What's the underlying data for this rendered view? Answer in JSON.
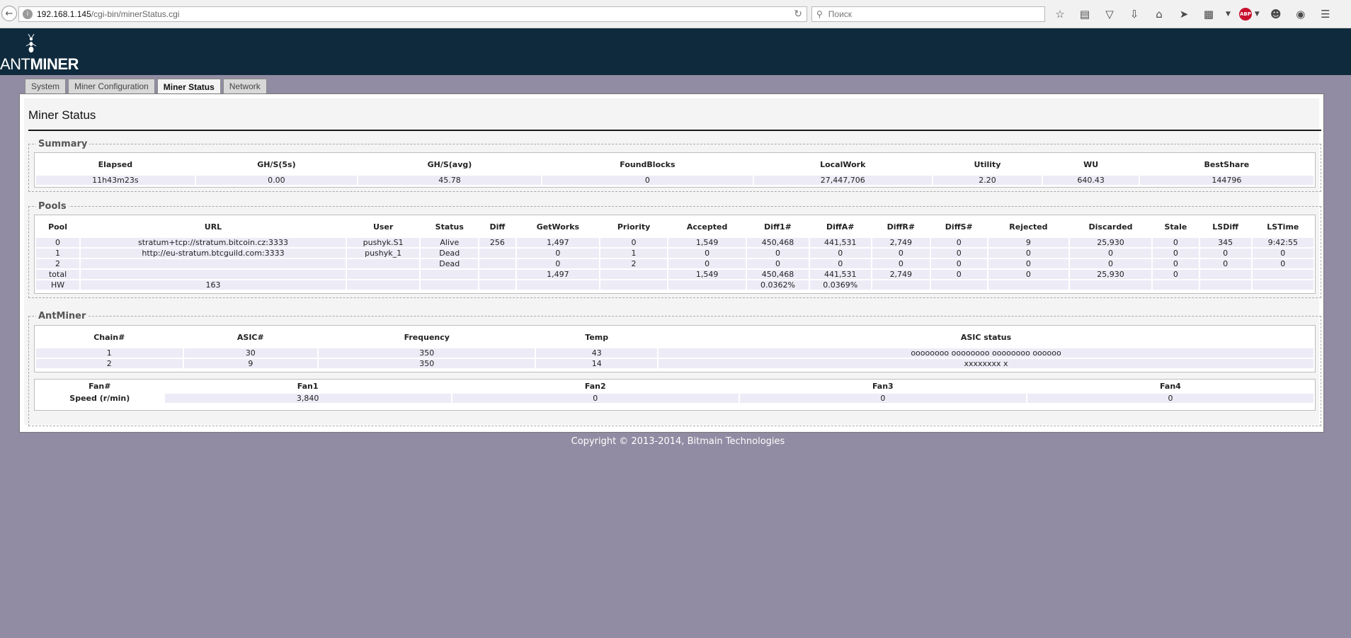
{
  "browser": {
    "url_host": "192.168.1.145",
    "url_path": "/cgi-bin/minerStatus.cgi",
    "search_placeholder": "Поиск",
    "abp_label": "ABP"
  },
  "brand": {
    "logo_ant": "ANT",
    "logo_miner": "MINER"
  },
  "tabs": [
    {
      "label": "System",
      "active": false
    },
    {
      "label": "Miner Configuration",
      "active": false
    },
    {
      "label": "Miner Status",
      "active": true
    },
    {
      "label": "Network",
      "active": false
    }
  ],
  "page_title": "Miner Status",
  "summary": {
    "legend": "Summary",
    "headers": [
      "Elapsed",
      "GH/S(5s)",
      "GH/S(avg)",
      "FoundBlocks",
      "LocalWork",
      "Utility",
      "WU",
      "BestShare"
    ],
    "row": [
      "11h43m23s",
      "0.00",
      "45.78",
      "0",
      "27,447,706",
      "2.20",
      "640.43",
      "144796"
    ]
  },
  "pools": {
    "legend": "Pools",
    "headers": [
      "Pool",
      "URL",
      "User",
      "Status",
      "Diff",
      "GetWorks",
      "Priority",
      "Accepted",
      "Diff1#",
      "DiffA#",
      "DiffR#",
      "DiffS#",
      "Rejected",
      "Discarded",
      "Stale",
      "LSDiff",
      "LSTime"
    ],
    "rows": [
      [
        "0",
        "stratum+tcp://stratum.bitcoin.cz:3333",
        "pushyk.S1",
        "Alive",
        "256",
        "1,497",
        "0",
        "1,549",
        "450,468",
        "441,531",
        "2,749",
        "0",
        "9",
        "25,930",
        "0",
        "345",
        "9:42:55"
      ],
      [
        "1",
        "http://eu-stratum.btcguild.com:3333",
        "pushyk_1",
        "Dead",
        "",
        "0",
        "1",
        "0",
        "0",
        "0",
        "0",
        "0",
        "0",
        "0",
        "0",
        "0",
        "0"
      ],
      [
        "2",
        "",
        "",
        "Dead",
        "",
        "0",
        "2",
        "0",
        "0",
        "0",
        "0",
        "0",
        "0",
        "0",
        "0",
        "0",
        "0"
      ],
      [
        "total",
        "",
        "",
        "",
        "",
        "1,497",
        "",
        "1,549",
        "450,468",
        "441,531",
        "2,749",
        "0",
        "0",
        "25,930",
        "0",
        "",
        ""
      ],
      [
        "HW",
        "163",
        "",
        "",
        "",
        "",
        "",
        "",
        "0.0362%",
        "0.0369%",
        "",
        "",
        "",
        "",
        "",
        "",
        ""
      ]
    ]
  },
  "antminer": {
    "legend": "AntMiner",
    "headers": [
      "Chain#",
      "ASIC#",
      "Frequency",
      "Temp",
      "ASIC status"
    ],
    "rows": [
      [
        "1",
        "30",
        "350",
        "43",
        "oooooooo oooooooo oooooooo oooooo"
      ],
      [
        "2",
        "9",
        "350",
        "14",
        "xxxxxxxx x"
      ]
    ],
    "fan_headers": [
      "Fan#",
      "Fan1",
      "Fan2",
      "Fan3",
      "Fan4"
    ],
    "fan_row_label": "Speed (r/min)",
    "fan_speeds": [
      "3,840",
      "0",
      "0",
      "0"
    ]
  },
  "footer": "Copyright © 2013-2014, Bitmain Technologies"
}
